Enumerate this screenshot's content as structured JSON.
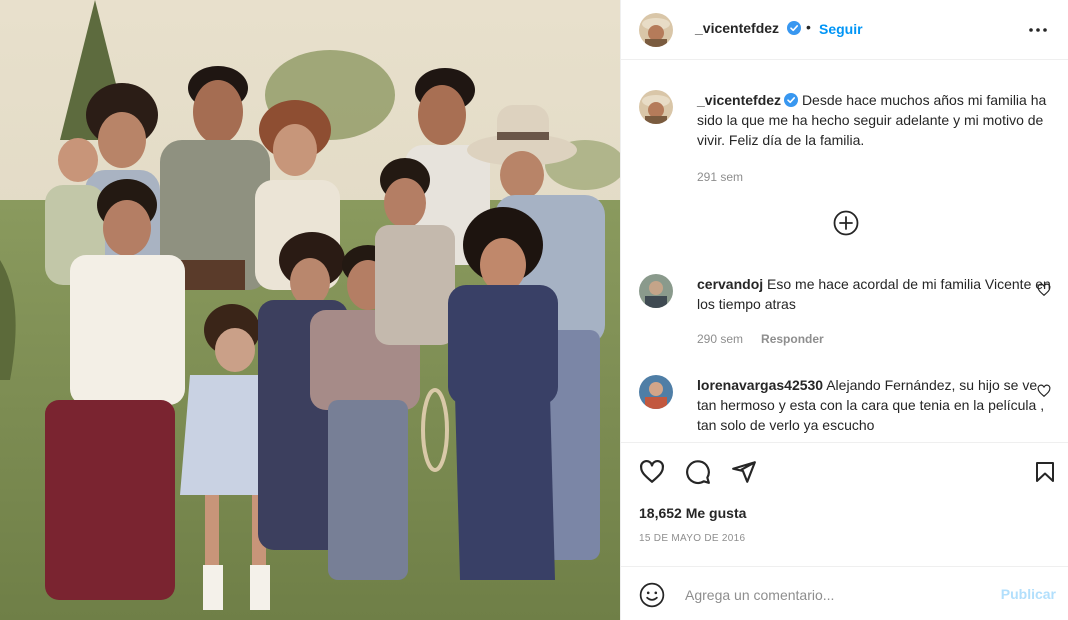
{
  "post": {
    "username": "_vicentefdez",
    "follow_label": "Seguir",
    "separator": "•",
    "caption": "Desde hace muchos años mi familia ha sido la que me ha hecho seguir adelante y mi motivo de vivir. Feliz día de la familia.",
    "caption_age": "291 sem",
    "likes": "18,652 Me gusta",
    "date": "15 DE MAYO DE 2016"
  },
  "comments": [
    {
      "username": "cervandoj",
      "text": "Eso me hace acordal de mi familia Vicente en los tiempo atras",
      "age": "290 sem",
      "reply_label": "Responder"
    },
    {
      "username": "lorenavargas42530",
      "text": "Alejando Fernández, su hijo se ve tan hermoso y esta con la cara que tenia en la película , tan solo de verlo ya escucho"
    }
  ],
  "composer": {
    "placeholder": "Agrega un comentario...",
    "publish_label": "Publicar"
  },
  "icons": {
    "verified": "verified-badge-icon",
    "more": "more-options-icon",
    "load_more": "plus-circle-icon",
    "like": "heart-icon",
    "comment": "comment-bubble-icon",
    "share": "paper-plane-icon",
    "save": "bookmark-icon",
    "emoji": "emoji-smile-icon"
  },
  "colors": {
    "accent": "#0095f6",
    "publish_disabled": "#b2dffc",
    "verified": "#3897f0",
    "muted": "#8e8e8e",
    "text": "#262626"
  }
}
